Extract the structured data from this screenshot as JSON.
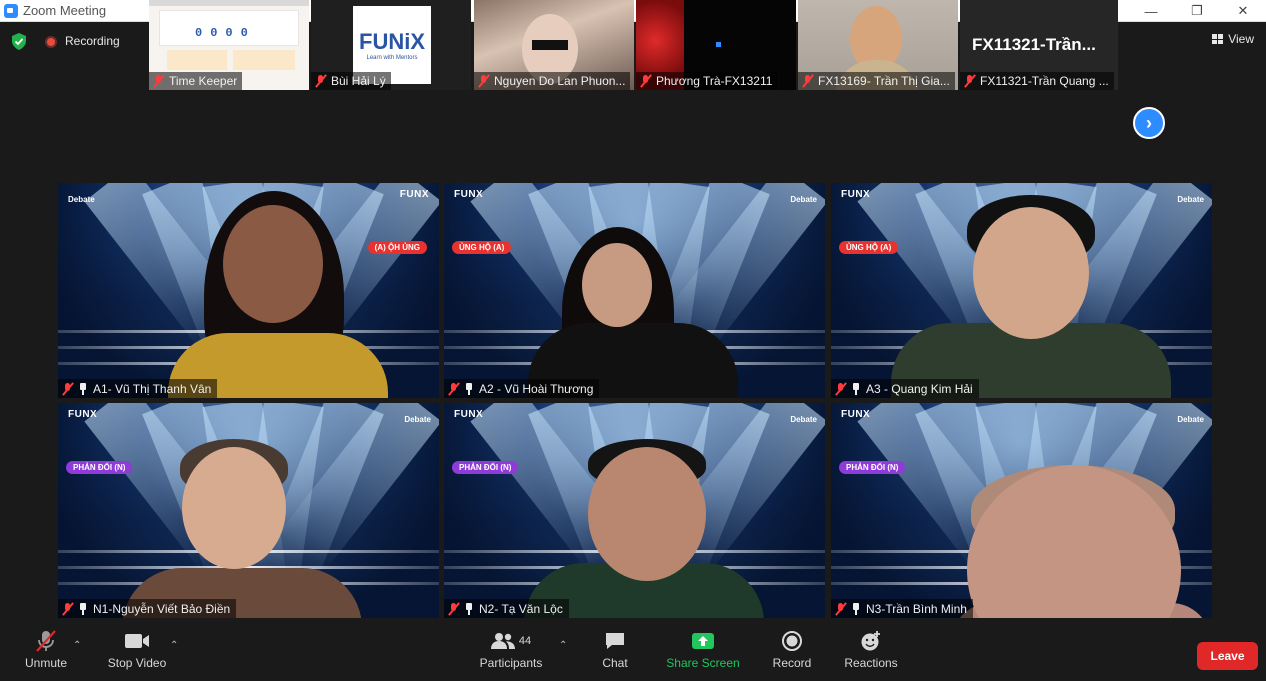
{
  "window": {
    "title": "Zoom Meeting"
  },
  "topbar": {
    "recording_label": "Recording",
    "view_label": "View"
  },
  "strip": [
    {
      "name": "Time Keeper",
      "kind": "screen",
      "counter": [
        "0",
        "0",
        "0",
        "0"
      ]
    },
    {
      "name": "Bùi Hải Lý",
      "kind": "logo",
      "logo_text": "FUNiX",
      "logo_sub": "Learn with Mentors"
    },
    {
      "name": "Nguyen Do Lan Phuon...",
      "kind": "video"
    },
    {
      "name": "Phương Trà-FX13211",
      "kind": "video"
    },
    {
      "name": "FX13169- Trần Thị Gia...",
      "kind": "video"
    },
    {
      "name": "FX11321-Trần Quang ...",
      "kind": "text",
      "display_text": "FX11321-Trần..."
    }
  ],
  "tiles": [
    {
      "name": "A1- Vũ Thị Thanh Vân",
      "badge": "(A) ỘH ỦNG",
      "badge_color": "#e8322f"
    },
    {
      "name": "A2 - Vũ Hoài Thương",
      "badge": "ỦNG HỘ (A)",
      "badge_color": "#e8322f"
    },
    {
      "name": "A3 - Quang Kim Hải",
      "badge": "ỦNG HỘ (A)",
      "badge_color": "#e8322f"
    },
    {
      "name": "N1-Nguyễn Viết Bảo Điền",
      "badge": "PHẢN ĐỐI (N)",
      "badge_color": "#8e3bd8"
    },
    {
      "name": "N2- Tạ Văn Lộc",
      "badge": "PHẢN ĐỐI (N)",
      "badge_color": "#8e3bd8"
    },
    {
      "name": "N3-Trần Bình Minh",
      "badge": "PHẢN ĐỐI (N)",
      "badge_color": "#8e3bd8"
    }
  ],
  "tile_logos": {
    "funx": "FUNX",
    "debate": "Debate"
  },
  "toolbar": {
    "unmute": "Unmute",
    "stop_video": "Stop Video",
    "participants": "Participants",
    "participants_count": "44",
    "chat": "Chat",
    "share_screen": "Share Screen",
    "record": "Record",
    "reactions": "Reactions",
    "leave": "Leave"
  },
  "colors": {
    "accent": "#2d8cff",
    "share_green": "#22c55e",
    "leave_red": "#e02828",
    "muted_red": "#ff3b3b"
  }
}
